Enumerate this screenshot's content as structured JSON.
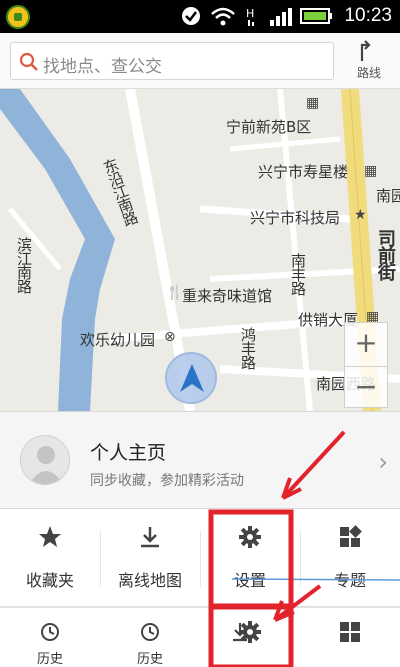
{
  "status_bar": {
    "time": "10:23",
    "icons": [
      "app-icon",
      "check-icon",
      "wifi-icon",
      "signal-icon",
      "battery-icon"
    ]
  },
  "search": {
    "placeholder": "找地点、查公交",
    "route_label": "路线"
  },
  "map": {
    "labels": {
      "l1": "宁前新苑B区",
      "l2": "兴宁市寿星楼",
      "l3": "兴宁市科技局",
      "l4": "南园",
      "l5": "东沿江南路",
      "l6": "滨江南路",
      "l7": "重来奇味道馆",
      "l8": "南丰路",
      "l9": "供销大厦",
      "l10": "欢乐幼儿园",
      "l11": "鸿丰路",
      "l12": "南园西路",
      "l13": "司前街"
    },
    "zoom_in": "+",
    "zoom_out": "−"
  },
  "profile": {
    "title": "个人主页",
    "subtitle": "同步收藏，参加精彩活动",
    "chevron": "›"
  },
  "menu": [
    {
      "label": "收藏夹",
      "icon": "star-icon"
    },
    {
      "label": "离线地图",
      "icon": "download-icon"
    },
    {
      "label": "设置",
      "icon": "gear-icon"
    },
    {
      "label": "专题",
      "icon": "grid-icon"
    }
  ],
  "bottom": [
    {
      "label": "历史",
      "icon": "clock-icon"
    },
    {
      "label": "历史",
      "icon": "clock-icon"
    }
  ],
  "colors": {
    "annotation": "#e3232c",
    "river": "#8fb3d9",
    "road_yellow": "#f0dc7c",
    "locator": "#2a73c9"
  }
}
